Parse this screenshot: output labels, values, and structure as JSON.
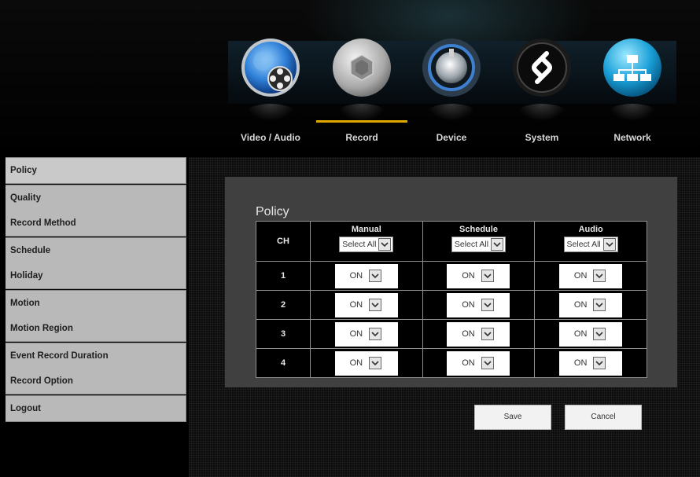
{
  "nav": {
    "items": [
      {
        "label": "Video / Audio",
        "icon": "video-audio-icon"
      },
      {
        "label": "Record",
        "icon": "record-icon"
      },
      {
        "label": "Device",
        "icon": "device-icon"
      },
      {
        "label": "System",
        "icon": "system-icon"
      },
      {
        "label": "Network",
        "icon": "network-icon"
      }
    ],
    "active": "Record",
    "accent": "#e0a800"
  },
  "sidebar": {
    "items": [
      "Policy",
      "Quality",
      "Record Method",
      "Schedule",
      "Holiday",
      "Motion",
      "Motion Region",
      "Event Record Duration",
      "Record Option",
      "Logout"
    ],
    "active": "Policy"
  },
  "panel": {
    "title": "Policy",
    "ch_header": "CH",
    "columns": [
      {
        "name": "Manual",
        "select_all": "Select All"
      },
      {
        "name": "Schedule",
        "select_all": "Select All"
      },
      {
        "name": "Audio",
        "select_all": "Select All"
      }
    ],
    "rows": [
      {
        "ch": "1",
        "values": [
          "ON",
          "ON",
          "ON"
        ]
      },
      {
        "ch": "2",
        "values": [
          "ON",
          "ON",
          "ON"
        ]
      },
      {
        "ch": "3",
        "values": [
          "ON",
          "ON",
          "ON"
        ]
      },
      {
        "ch": "4",
        "values": [
          "ON",
          "ON",
          "ON"
        ]
      }
    ]
  },
  "buttons": {
    "save": "Save",
    "cancel": "Cancel"
  }
}
